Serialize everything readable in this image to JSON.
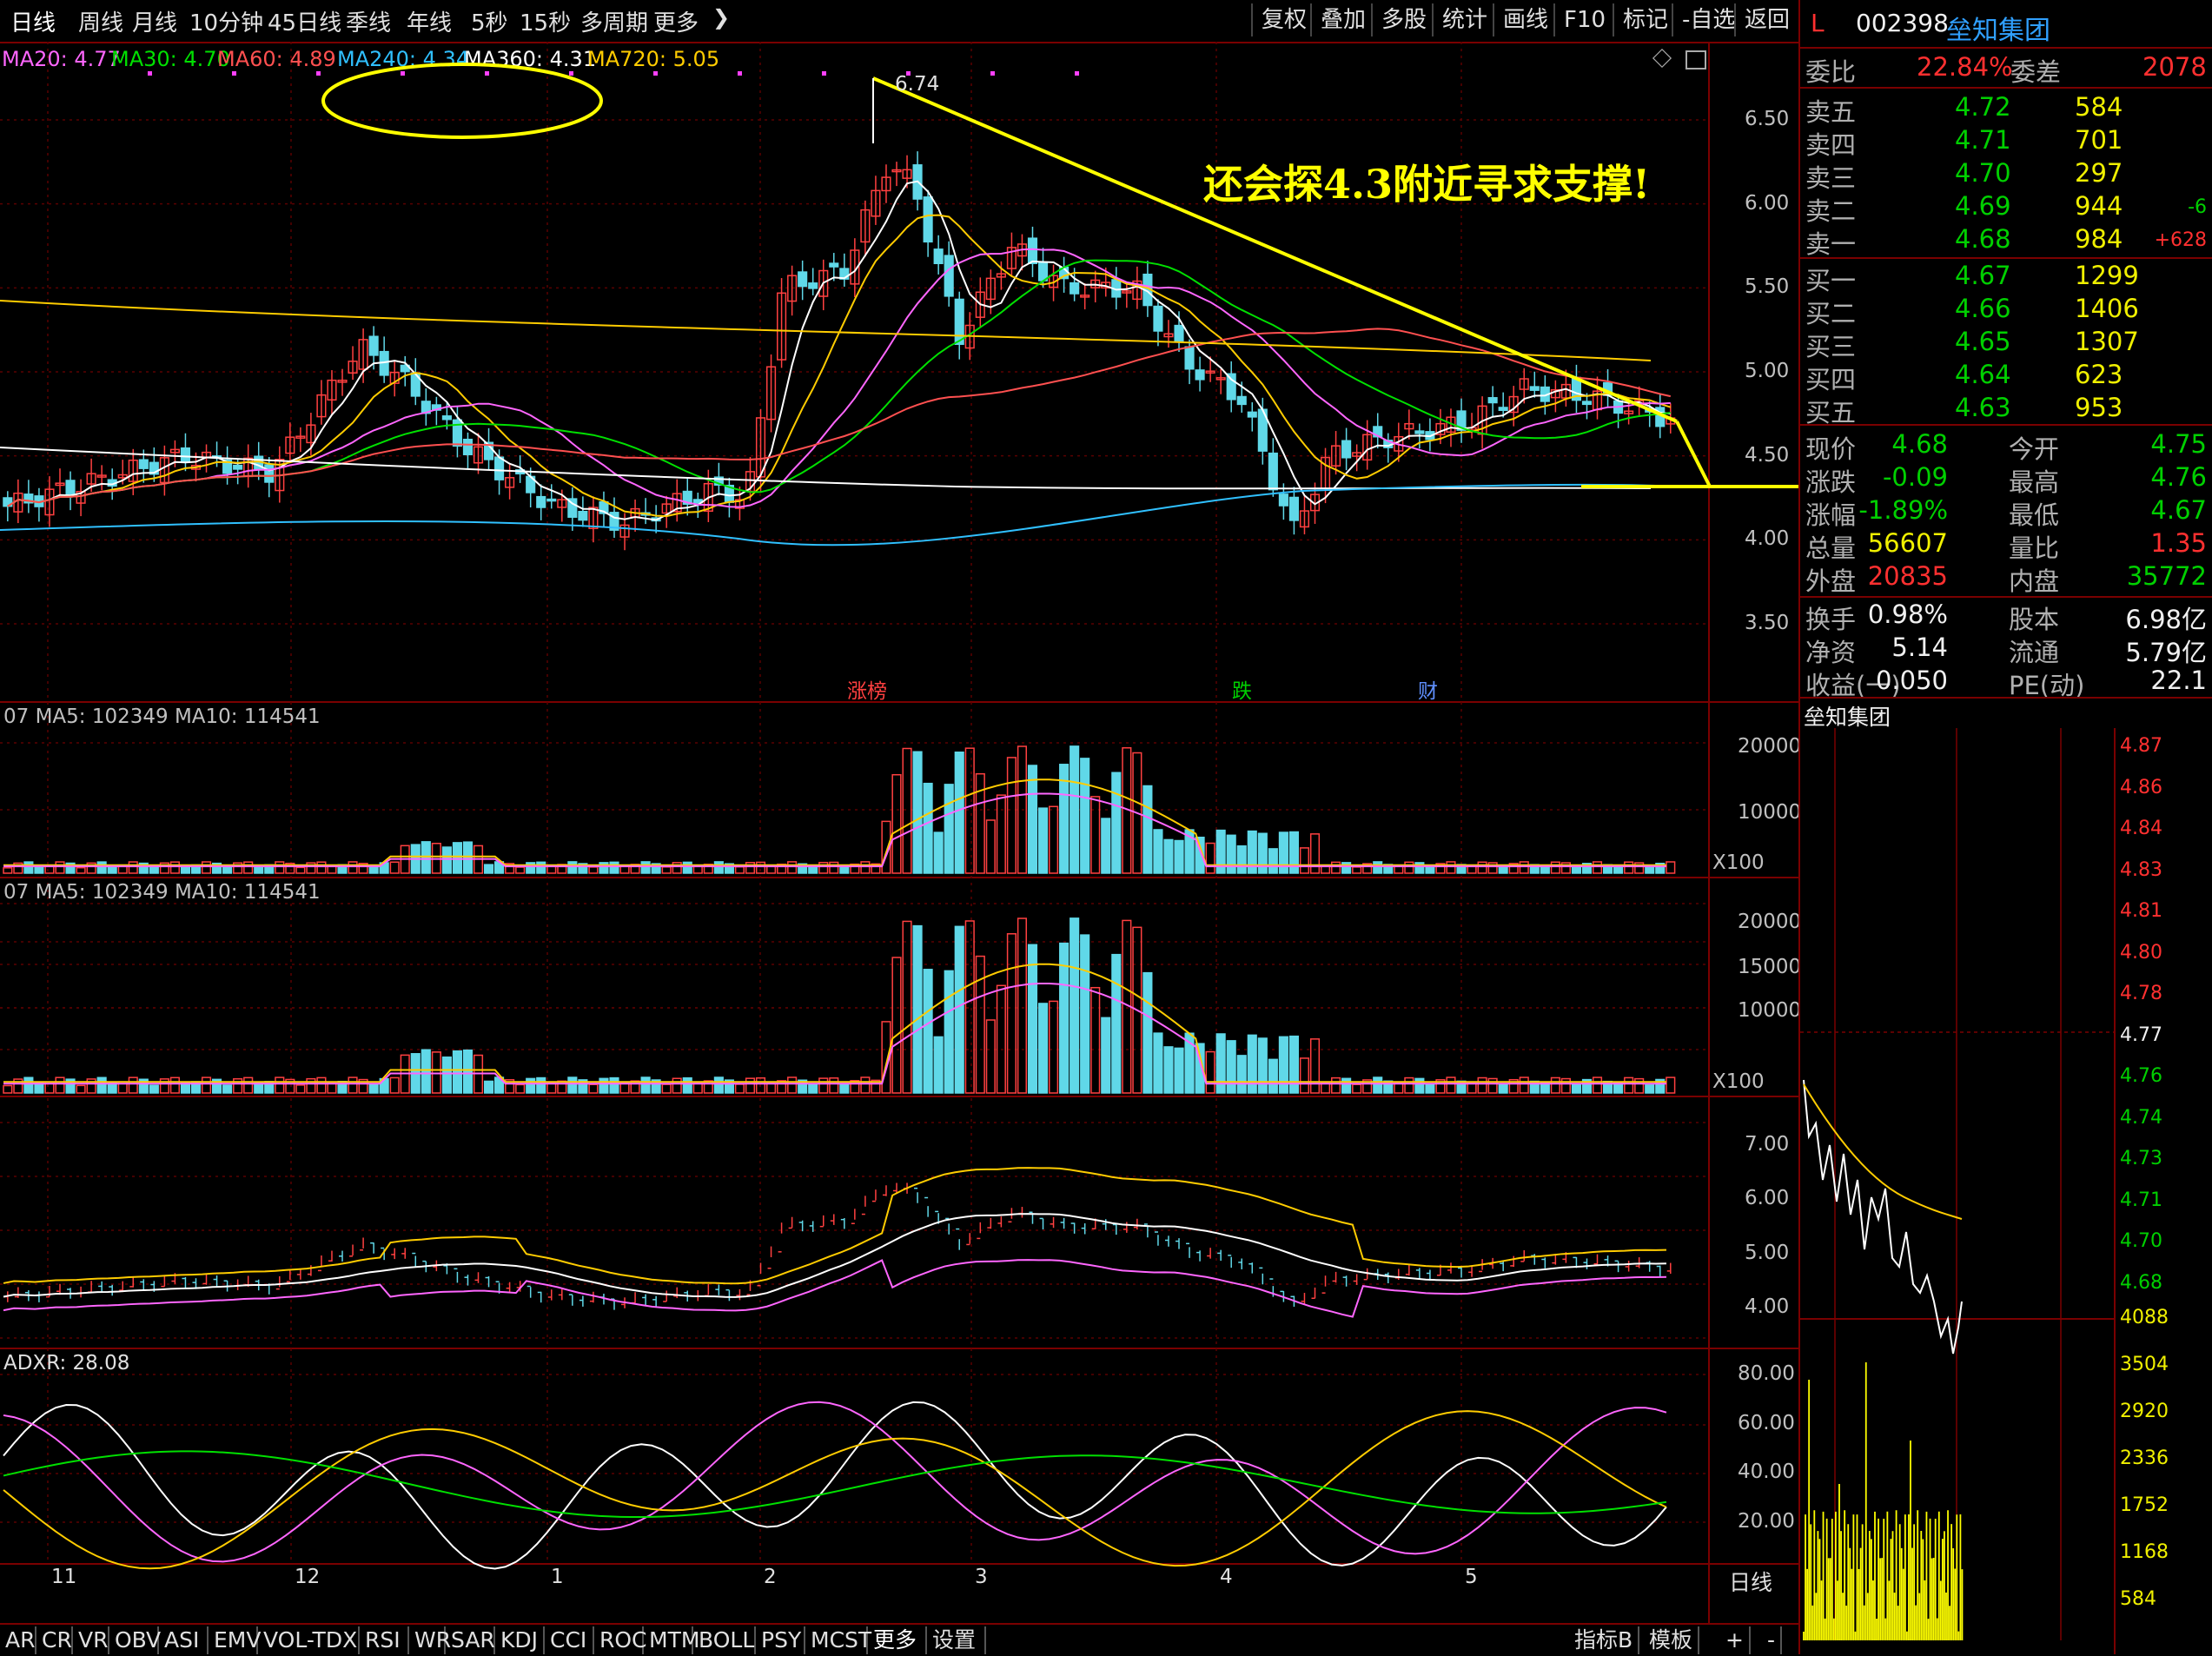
{
  "toolbar": {
    "period_tabs": [
      "日线",
      "周线",
      "月线",
      "10分钟",
      "45日线",
      "季线",
      "年线",
      "5秒",
      "15秒",
      "多周期",
      "更多"
    ],
    "more_chevron": "chevron-right",
    "right_buttons": [
      "复权",
      "叠加",
      "多股",
      "统计",
      "画线",
      "F10",
      "标记",
      "-自选",
      "返回"
    ]
  },
  "ma_line": {
    "items": [
      {
        "label": "MA20: 4.77",
        "color": "#ff66ff"
      },
      {
        "label": "MA30: 4.70",
        "color": "#00e000"
      },
      {
        "label": "MA60: 4.89",
        "color": "#ff5050"
      },
      {
        "label": "MA240: 4.34",
        "color": "#30c0ff"
      },
      {
        "label": "MA360: 4.31",
        "color": "#ffffff"
      },
      {
        "label": "MA720: 5.05",
        "color": "#ffcc00"
      }
    ]
  },
  "price_axis": [
    "6.50",
    "6.00",
    "5.50",
    "5.00",
    "4.50",
    "4.00",
    "3.50"
  ],
  "high_marker": "6.74",
  "annotation": "还会探4.3附近寻求支撑!",
  "event_tags": [
    {
      "label": "涨榜",
      "color": "#ff4040"
    },
    {
      "label": "跌",
      "color": "#00d000"
    },
    {
      "label": "财",
      "color": "#6090ff"
    }
  ],
  "volume_panel_1": {
    "label": "07  MA5: 102349  MA10: 114541",
    "axis": [
      "20000",
      "10000"
    ],
    "unit": "X100"
  },
  "volume_panel_2": {
    "label": "07  MA5: 102349  MA10: 114541",
    "axis": [
      "20000",
      "15000",
      "10000"
    ],
    "unit": "X100"
  },
  "boll_panel": {
    "axis": [
      "7.00",
      "6.00",
      "5.00",
      "4.00"
    ]
  },
  "dmi_panel": {
    "label": "ADXR: 28.08",
    "axis": [
      "80.00",
      "60.00",
      "40.00",
      "20.00"
    ]
  },
  "date_axis": [
    "11",
    "12",
    "1",
    "2",
    "3",
    "4",
    "5"
  ],
  "period_label": "日线",
  "bottom_tabs": [
    "AR",
    "CR",
    "VR",
    "OBV",
    "ASI",
    "EMV",
    "VOL-TDX",
    "RSI",
    "WR",
    "SAR",
    "KDJ",
    "CCI",
    "ROC",
    "MTM",
    "BOLL",
    "PSY",
    "MCST",
    "更多",
    "设置"
  ],
  "bottom_right": [
    "指标B",
    "模板",
    "+",
    "-"
  ],
  "quote": {
    "market_tag": "L",
    "code": "002398",
    "name": "垒知集团",
    "weibi_label": "委比",
    "weibi": "22.84%",
    "weicha_label": "委差",
    "weicha": "2078",
    "asks": [
      {
        "label": "卖五",
        "price": "4.72",
        "vol": "584",
        "chg": ""
      },
      {
        "label": "卖四",
        "price": "4.71",
        "vol": "701",
        "chg": ""
      },
      {
        "label": "卖三",
        "price": "4.70",
        "vol": "297",
        "chg": ""
      },
      {
        "label": "卖二",
        "price": "4.69",
        "vol": "944",
        "chg": "-6"
      },
      {
        "label": "卖一",
        "price": "4.68",
        "vol": "984",
        "chg": "+628"
      }
    ],
    "bids": [
      {
        "label": "买一",
        "price": "4.67",
        "vol": "1299"
      },
      {
        "label": "买二",
        "price": "4.66",
        "vol": "1406"
      },
      {
        "label": "买三",
        "price": "4.65",
        "vol": "1307"
      },
      {
        "label": "买四",
        "price": "4.64",
        "vol": "623"
      },
      {
        "label": "买五",
        "price": "4.63",
        "vol": "953"
      }
    ],
    "stats": [
      {
        "l1": "现价",
        "v1": "4.68",
        "c1": "green",
        "l2": "今开",
        "v2": "4.75",
        "c2": "green"
      },
      {
        "l1": "涨跌",
        "v1": "-0.09",
        "c1": "green",
        "l2": "最高",
        "v2": "4.76",
        "c2": "green"
      },
      {
        "l1": "涨幅",
        "v1": "-1.89%",
        "c1": "green",
        "l2": "最低",
        "v2": "4.67",
        "c2": "green"
      },
      {
        "l1": "总量",
        "v1": "56607",
        "c1": "yellow",
        "l2": "量比",
        "v2": "1.35",
        "c2": "red"
      },
      {
        "l1": "外盘",
        "v1": "20835",
        "c1": "red",
        "l2": "内盘",
        "v2": "35772",
        "c2": "green"
      }
    ],
    "stats2": [
      {
        "l1": "换手",
        "v1": "0.98%",
        "l2": "股本",
        "v2": "6.98亿"
      },
      {
        "l1": "净资",
        "v1": "5.14",
        "l2": "流通",
        "v2": "5.79亿"
      },
      {
        "l1": "收益(一)",
        "v1": "0.050",
        "l2": "PE(动)",
        "v2": "22.1"
      }
    ],
    "mini_title": "垒知集团",
    "mini_price_axis": [
      "4.87",
      "4.86",
      "4.84",
      "4.83",
      "4.81",
      "4.80",
      "4.78",
      "4.77",
      "4.76",
      "4.74",
      "4.73",
      "4.71",
      "4.70",
      "4.68"
    ],
    "mini_vol_axis": [
      "4088",
      "3504",
      "2920",
      "2336",
      "1752",
      "1168",
      "584"
    ]
  }
}
